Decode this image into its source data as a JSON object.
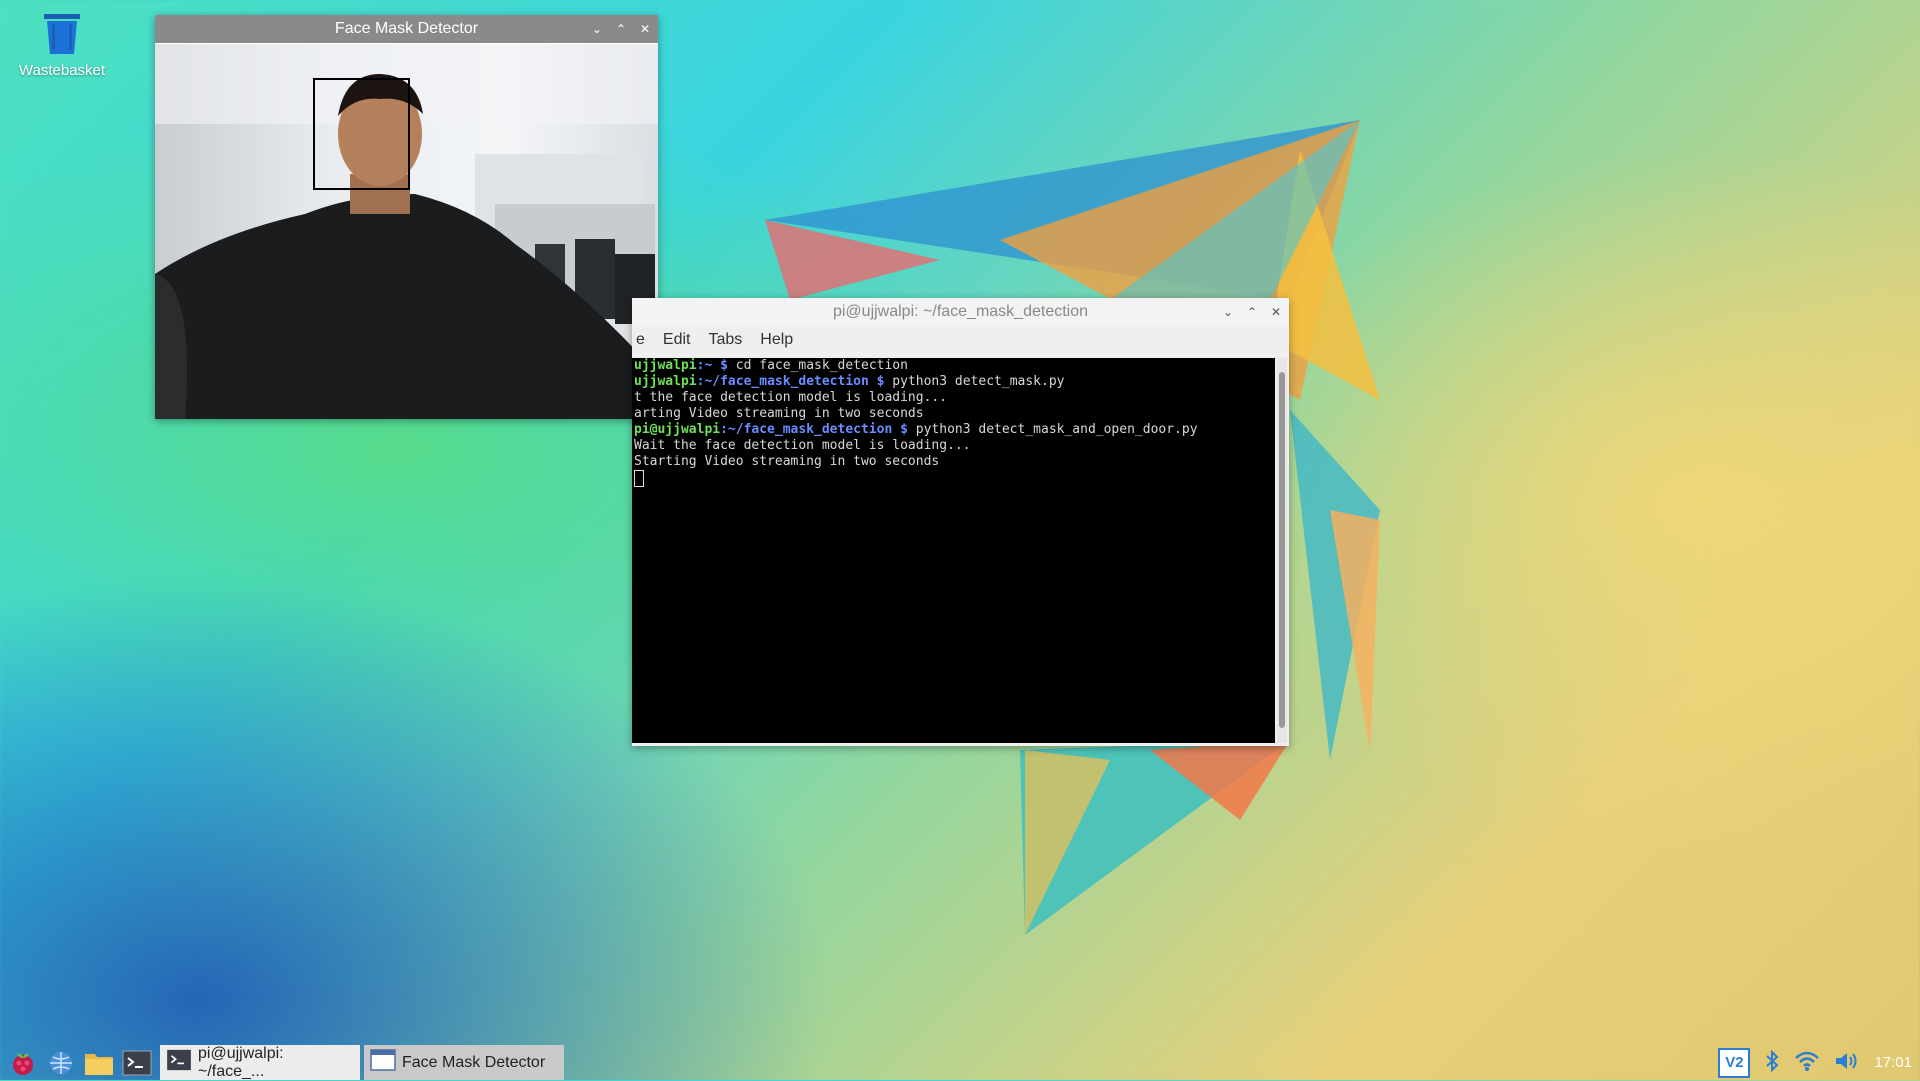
{
  "desktop": {
    "icons": [
      {
        "label": "Wastebasket",
        "icon": "trash-icon"
      }
    ]
  },
  "face_window": {
    "title": "Face Mask Detector",
    "controls": {
      "minimize": "⌄",
      "maximize": "⌃",
      "close": "✕"
    }
  },
  "terminal_window": {
    "title": "pi@ujjwalpi: ~/face_mask_detection",
    "controls": {
      "minimize": "⌄",
      "maximize": "⌃",
      "close": "✕"
    },
    "menu": [
      "e",
      "Edit",
      "Tabs",
      "Help"
    ],
    "lines": [
      {
        "user": "ujjwalpi",
        "path": ":~ $",
        "cmd": " cd face_mask_detection"
      },
      {
        "user": "ujjwalpi",
        "path": ":~/face_mask_detection $",
        "cmd": " python3 detect_mask.py"
      },
      {
        "text": "t the face detection model is loading..."
      },
      {
        "text": "arting Video streaming in two seconds"
      },
      {
        "user": "pi@ujjwalpi",
        "path": ":~/face_mask_detection $",
        "cmd": " python3 detect_mask_and_open_door.py"
      },
      {
        "text": "Wait the face detection model is loading..."
      },
      {
        "text": "Starting Video streaming in two seconds"
      }
    ]
  },
  "taskbar": {
    "launchers": [
      "raspberry-menu-icon",
      "browser-icon",
      "file-manager-icon",
      "terminal-icon"
    ],
    "tasks": [
      {
        "label": "pi@ujjwalpi: ~/face_...",
        "icon": "terminal-icon",
        "active": true
      },
      {
        "label": "Face Mask Detector",
        "icon": "window-icon",
        "active": false
      }
    ],
    "tray": {
      "vnc": "V2",
      "clock": "17:01"
    }
  }
}
